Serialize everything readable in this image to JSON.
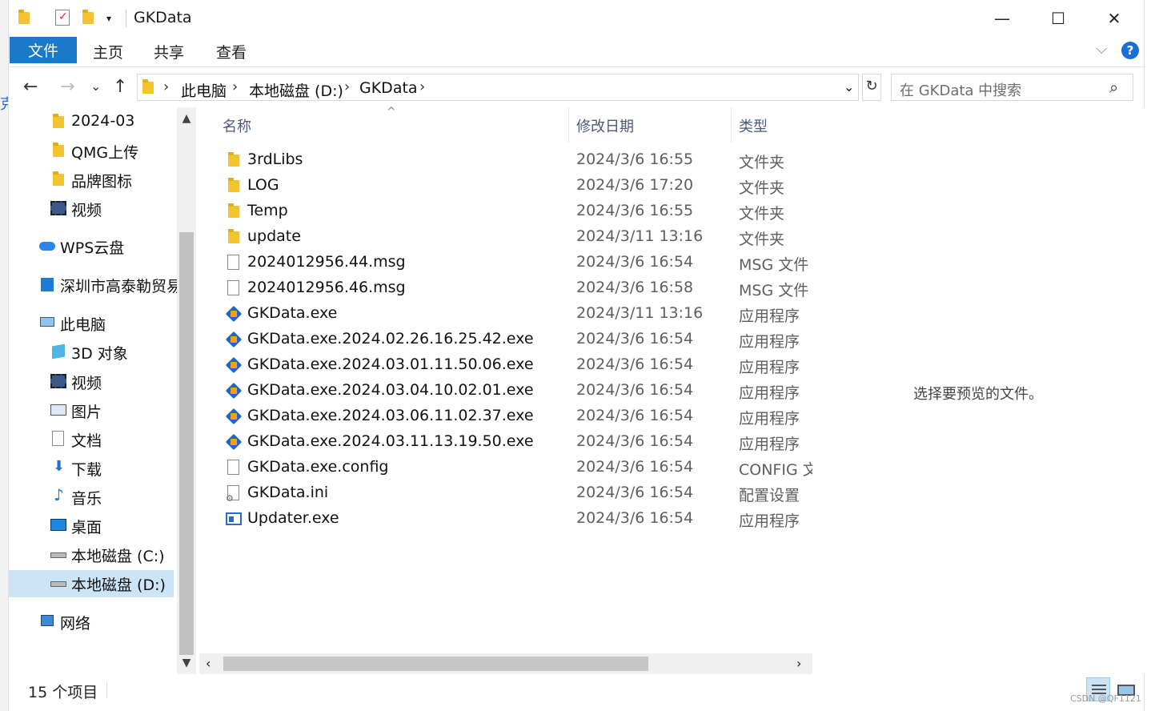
{
  "window": {
    "title": "GKData",
    "minimize": "—",
    "maximize": "☐",
    "close": "✕",
    "edge_text": "克"
  },
  "ribbon": {
    "tabs": [
      "文件",
      "主页",
      "共享",
      "查看"
    ],
    "collapse": "⌵",
    "help": "?"
  },
  "nav": {
    "back": "←",
    "forward": "→",
    "recent": "⌄",
    "up": "↑",
    "breadcrumb": [
      "此电脑",
      "本地磁盘 (D:)",
      "GKData"
    ],
    "dropdown": "⌄",
    "refresh": "↻",
    "search_placeholder": "在 GKData 中搜索",
    "search_icon": "⌕"
  },
  "sidebar": {
    "items": [
      {
        "label": "2024-03",
        "icon": "folder-icon"
      },
      {
        "label": "QMG上传",
        "icon": "folder-icon"
      },
      {
        "label": "品牌图标",
        "icon": "folder-icon"
      },
      {
        "label": "视频",
        "icon": "video-icon"
      },
      {
        "label": "WPS云盘",
        "icon": "cloud-icon"
      },
      {
        "label": "深圳市高泰勒贸易",
        "icon": "building-icon"
      },
      {
        "label": "此电脑",
        "icon": "computer-icon"
      },
      {
        "label": "3D 对象",
        "icon": "cube-icon"
      },
      {
        "label": "视频",
        "icon": "video-icon"
      },
      {
        "label": "图片",
        "icon": "picture-icon"
      },
      {
        "label": "文档",
        "icon": "document-icon"
      },
      {
        "label": "下载",
        "icon": "download-icon"
      },
      {
        "label": "音乐",
        "icon": "music-icon"
      },
      {
        "label": "桌面",
        "icon": "desktop-icon"
      },
      {
        "label": "本地磁盘 (C:)",
        "icon": "drive-icon"
      },
      {
        "label": "本地磁盘 (D:)",
        "icon": "drive-icon"
      },
      {
        "label": "网络",
        "icon": "network-icon"
      }
    ],
    "selected": "本地磁盘 (D:)"
  },
  "columns": {
    "name": "名称",
    "date": "修改日期",
    "type": "类型"
  },
  "files": [
    {
      "name": "3rdLibs",
      "date": "2024/3/6 16:55",
      "type": "文件夹",
      "icon": "folder-icon"
    },
    {
      "name": "LOG",
      "date": "2024/3/6 17:20",
      "type": "文件夹",
      "icon": "folder-icon"
    },
    {
      "name": "Temp",
      "date": "2024/3/6 16:55",
      "type": "文件夹",
      "icon": "folder-icon"
    },
    {
      "name": "update",
      "date": "2024/3/11 13:16",
      "type": "文件夹",
      "icon": "folder-icon"
    },
    {
      "name": "2024012956.44.msg",
      "date": "2024/3/6 16:54",
      "type": "MSG 文件",
      "icon": "file-icon"
    },
    {
      "name": "2024012956.46.msg",
      "date": "2024/3/6 16:58",
      "type": "MSG 文件",
      "icon": "file-icon"
    },
    {
      "name": "GKData.exe",
      "date": "2024/3/11 13:16",
      "type": "应用程序",
      "icon": "app-icon"
    },
    {
      "name": "GKData.exe.2024.02.26.16.25.42.exe",
      "date": "2024/3/6 16:54",
      "type": "应用程序",
      "icon": "app-icon"
    },
    {
      "name": "GKData.exe.2024.03.01.11.50.06.exe",
      "date": "2024/3/6 16:54",
      "type": "应用程序",
      "icon": "app-icon"
    },
    {
      "name": "GKData.exe.2024.03.04.10.02.01.exe",
      "date": "2024/3/6 16:54",
      "type": "应用程序",
      "icon": "app-icon"
    },
    {
      "name": "GKData.exe.2024.03.06.11.02.37.exe",
      "date": "2024/3/6 16:54",
      "type": "应用程序",
      "icon": "app-icon"
    },
    {
      "name": "GKData.exe.2024.03.11.13.19.50.exe",
      "date": "2024/3/6 16:54",
      "type": "应用程序",
      "icon": "app-icon"
    },
    {
      "name": "GKData.exe.config",
      "date": "2024/3/6 16:54",
      "type": "CONFIG 文",
      "icon": "file-icon"
    },
    {
      "name": "GKData.ini",
      "date": "2024/3/6 16:54",
      "type": "配置设置",
      "icon": "settings-file-icon"
    },
    {
      "name": "Updater.exe",
      "date": "2024/3/6 16:54",
      "type": "应用程序",
      "icon": "updater-icon"
    }
  ],
  "preview": {
    "message": "选择要预览的文件。"
  },
  "status": {
    "item_count": "15 个项目",
    "watermark": "CSDN @QF1121"
  },
  "colors": {
    "accent": "#1979ca",
    "selected": "#cce4f7",
    "folder": "#f3c330"
  }
}
